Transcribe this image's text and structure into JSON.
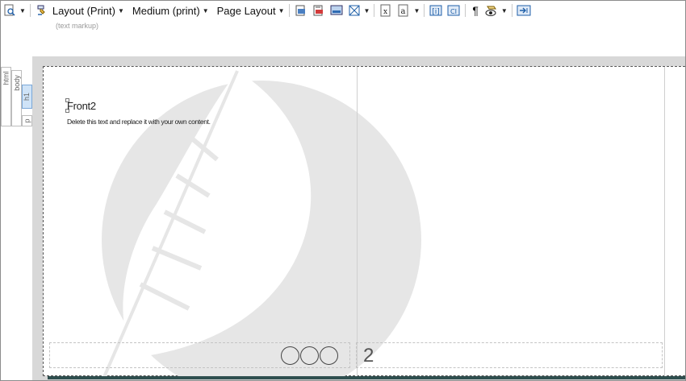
{
  "toolbar": {
    "layout_label": "Layout (Print)",
    "medium_label": "Medium (print)",
    "page_layout_label": "Page Layout",
    "paragraph_mark": "¶"
  },
  "status_hint": "(text markup)",
  "tags": {
    "html": "html",
    "body": "body",
    "h1": "h1",
    "p": "p"
  },
  "document": {
    "heading": "Front2",
    "paragraph": "Delete this text and replace it with your own content.",
    "page_number": "2"
  },
  "colors": {
    "canvas": "#d8d8d8",
    "watermark": "#e6e6e6",
    "active_tag": "#cfe3f7",
    "toolbar_icon": "#1f5fa8"
  },
  "icons": {
    "view": "magnifier-page-icon",
    "brush": "format-brush-icon",
    "insert": "insert-icon",
    "tags_toggle": "tags-icon",
    "print": "print-icon"
  }
}
